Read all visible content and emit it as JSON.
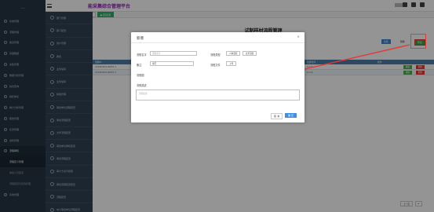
{
  "header": {
    "brand": "能采集综合管理平台"
  },
  "sidebar1": {
    "logo_text": "——",
    "items": [
      {
        "label": "系统管理"
      },
      {
        "label": "流程管理"
      },
      {
        "label": "报表管理"
      },
      {
        "label": "基础数据"
      },
      {
        "label": "采集管理"
      },
      {
        "label": "数据分析管理"
      },
      {
        "label": "综合查询"
      },
      {
        "label": "指标体系"
      },
      {
        "label": "统计分析管理"
      },
      {
        "label": "报告管理"
      },
      {
        "label": "任务管理"
      },
      {
        "label": "资料管理"
      },
      {
        "label": "流程审核"
      }
    ],
    "sub_items": [
      {
        "label": "流程定义管理"
      },
      {
        "label": "审批人员配置"
      },
      {
        "label": "流程配置与实例管理"
      }
    ],
    "bottom": {
      "label": "系统管理"
    }
  },
  "sidebar2": {
    "items": [
      {
        "label": "部门管理"
      },
      {
        "label": "部门配置"
      },
      {
        "label": "用户管理"
      },
      {
        "label": "角色"
      },
      {
        "label": "业务编码"
      },
      {
        "label": "业务编码"
      },
      {
        "label": "模板管理"
      },
      {
        "label": "审批单位流程配置"
      },
      {
        "label": "审批流程配置"
      },
      {
        "label": "文件流程配置"
      },
      {
        "label": "审批单位审核配置"
      },
      {
        "label": "审批流程配置"
      },
      {
        "label": "审计方法与模型"
      },
      {
        "label": "审批流程配置配置"
      },
      {
        "label": "流程配置"
      },
      {
        "label": "电子审批单位流程配置"
      }
    ]
  },
  "tabs": [
    {
      "label": "首页"
    },
    {
      "label": "流程管理"
    },
    {
      "label": "流程配置与实例"
    },
    {
      "label": "● 流程配置"
    }
  ],
  "content": {
    "page_title": "试制样材流程管理",
    "toolbar": {
      "add_label": "新增",
      "delete_label": "删除",
      "export_label": "导出"
    },
    "table": {
      "columns": [
        "流程ID",
        "流程名称",
        "流程状态",
        "创建时间",
        "操作"
      ],
      "rows": [
        {
          "id": "12345-89-6-00457-1",
          "name": "",
          "status": "",
          "time": "11:22",
          "edit": "编辑",
          "remove": "删除"
        },
        {
          "id": "12345-89-6-00457-1",
          "name": "",
          "status": "",
          "time": "11:22",
          "edit": "编辑",
          "remove": "删除"
        }
      ]
    },
    "pager": {
      "prev": "上一页",
      "next": "▸"
    }
  },
  "modal": {
    "title": "新增",
    "close": "×",
    "fields": {
      "name_label": "流程名字",
      "name_placeholder": "流程名字",
      "type_label": "流程类型",
      "type_btn1": "人事流程",
      "type_btn2": "业务流程",
      "remark_label": "备注",
      "remark_value": "填写",
      "file_label": "流程文件",
      "file_btn": "上传",
      "flow_label": "流程图",
      "desc_label": "流程描述",
      "desc_placeholder": "流程描述"
    },
    "cancel_label": "取 消",
    "ok_label": "确 定"
  },
  "colors": {
    "sidebar_dark": "#263445",
    "sidebar_mid": "#314254",
    "brand": "#9b1fbf",
    "primary": "#3f8fe2",
    "success": "#43a047",
    "danger": "#e53935",
    "table_head": "#4f7fa8"
  }
}
